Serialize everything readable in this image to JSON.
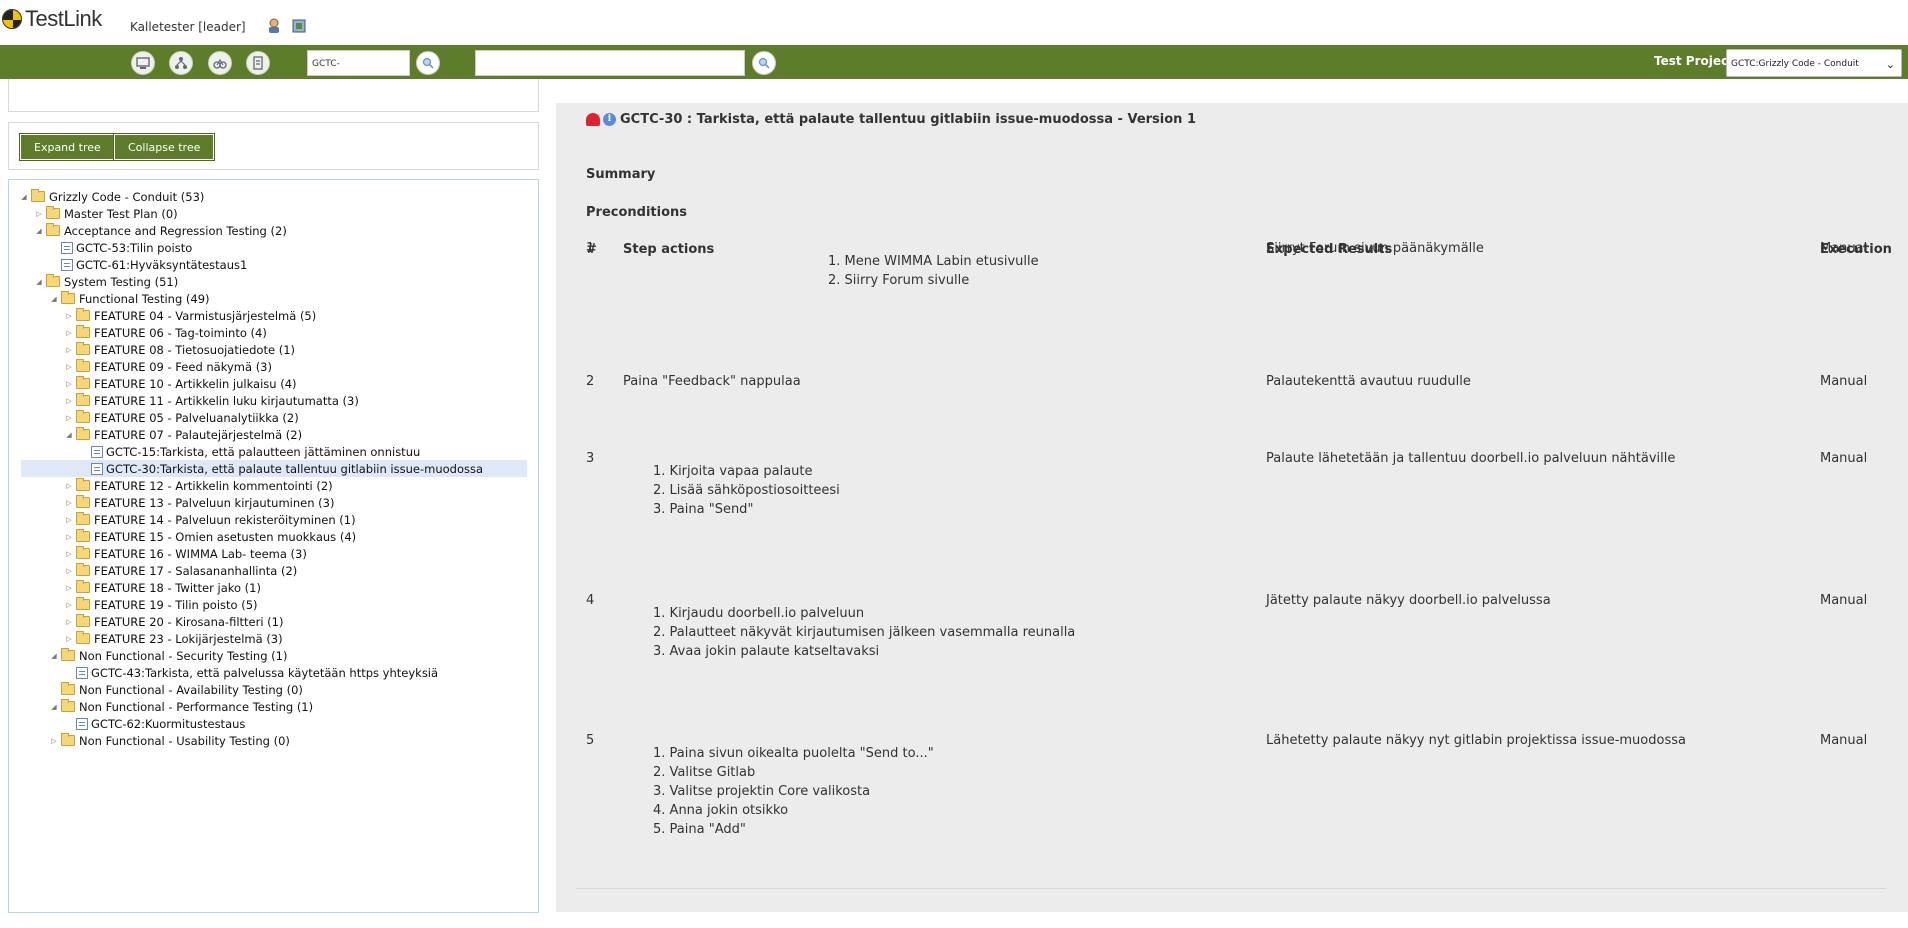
{
  "app": {
    "logo_text": "TestLink",
    "user": "Kalletester [leader]"
  },
  "nav": {
    "tc_input_value": "GCTC-",
    "search_value": "",
    "project_label": "Test Project",
    "project_selected": "GCTC:Grizzly Code - Conduit"
  },
  "left": {
    "expand_label": "Expand tree",
    "collapse_label": "Collapse tree"
  },
  "tree": [
    {
      "label": "Grizzly Code - Conduit (53)",
      "type": "folder",
      "toggle": "open"
    },
    {
      "label": "Master Test Plan (0)",
      "type": "folder",
      "toggle": "closed"
    },
    {
      "label": "Acceptance and Regression Testing (2)",
      "type": "folder",
      "toggle": "open"
    },
    {
      "label": "GCTC-53:Tilin poisto",
      "type": "tc",
      "toggle": ""
    },
    {
      "label": "GCTC-61:Hyväksyntätestaus1",
      "type": "tc",
      "toggle": ""
    },
    {
      "label": "System Testing (51)",
      "type": "folder",
      "toggle": "open"
    },
    {
      "label": "Functional Testing (49)",
      "type": "folder",
      "toggle": "open"
    },
    {
      "label": "FEATURE 04 - Varmistusjärjestelmä (5)",
      "type": "folder",
      "toggle": "closed"
    },
    {
      "label": "FEATURE 06 - Tag-toiminto (4)",
      "type": "folder",
      "toggle": "closed"
    },
    {
      "label": "FEATURE 08 - Tietosuojatiedote (1)",
      "type": "folder",
      "toggle": "closed"
    },
    {
      "label": "FEATURE 09 - Feed näkymä (3)",
      "type": "folder",
      "toggle": "closed"
    },
    {
      "label": "FEATURE 10 - Artikkelin julkaisu (4)",
      "type": "folder",
      "toggle": "closed"
    },
    {
      "label": "FEATURE 11 - Artikkelin luku kirjautumatta (3)",
      "type": "folder",
      "toggle": "closed"
    },
    {
      "label": "FEATURE 05 - Palveluanalytiikka (2)",
      "type": "folder",
      "toggle": "closed"
    },
    {
      "label": "FEATURE 07 - Palautejärjestelmä (2)",
      "type": "folder",
      "toggle": "open"
    },
    {
      "label": "GCTC-15:Tarkista, että palautteen jättäminen onnistuu",
      "type": "tc",
      "toggle": ""
    },
    {
      "label": "GCTC-30:Tarkista, että palaute tallentuu gitlabiin issue-muodossa",
      "type": "tc",
      "toggle": "",
      "selected": true
    },
    {
      "label": "FEATURE 12 - Artikkelin kommentointi (2)",
      "type": "folder",
      "toggle": "closed"
    },
    {
      "label": "FEATURE 13 - Palveluun kirjautuminen (3)",
      "type": "folder",
      "toggle": "closed"
    },
    {
      "label": "FEATURE 14 - Palveluun rekisteröityminen (1)",
      "type": "folder",
      "toggle": "closed"
    },
    {
      "label": "FEATURE 15 - Omien asetusten muokkaus (4)",
      "type": "folder",
      "toggle": "closed"
    },
    {
      "label": "FEATURE 16 - WIMMA Lab- teema (3)",
      "type": "folder",
      "toggle": "closed"
    },
    {
      "label": "FEATURE 17 - Salasananhallinta (2)",
      "type": "folder",
      "toggle": "closed"
    },
    {
      "label": "FEATURE 18 - Twitter jako (1)",
      "type": "folder",
      "toggle": "closed"
    },
    {
      "label": "FEATURE 19 - Tilin poisto (5)",
      "type": "folder",
      "toggle": "closed"
    },
    {
      "label": "FEATURE 20 - Kirosana-filtteri (1)",
      "type": "folder",
      "toggle": "closed"
    },
    {
      "label": "FEATURE 23 - Lokijärjestelmä (3)",
      "type": "folder",
      "toggle": "closed"
    },
    {
      "label": "Non Functional - Security Testing (1)",
      "type": "folder",
      "toggle": "open"
    },
    {
      "label": "GCTC-43:Tarkista, että palvelussa käytetään https yhteyksiä",
      "type": "tc",
      "toggle": ""
    },
    {
      "label": "Non Functional - Availability Testing (0)",
      "type": "folder",
      "toggle": ""
    },
    {
      "label": "Non Functional - Performance Testing (1)",
      "type": "folder",
      "toggle": "open"
    },
    {
      "label": "GCTC-62:Kuormitustestaus",
      "type": "tc",
      "toggle": ""
    },
    {
      "label": "Non Functional - Usability Testing (0)",
      "type": "folder",
      "toggle": "closed"
    }
  ],
  "tc": {
    "title": "GCTC-30 : Tarkista, että palaute tallentuu gitlabiin issue-muodossa - Version 1",
    "summary_label": "Summary",
    "preconditions_label": "Preconditions",
    "headers": {
      "num": "#",
      "actions": "Step actions",
      "expected": "Expected Results",
      "execution": "Execution"
    },
    "steps": [
      {
        "num": "1",
        "text": "",
        "list": [
          "Mene WIMMA Labin etusivulle",
          "Siirry Forum sivulle"
        ],
        "expected": "Siirryt Forum sivun päänäkymälle",
        "exec": "Manual"
      },
      {
        "num": "2",
        "text": "Paina \"Feedback\" nappulaa",
        "list": [],
        "expected": "Palautekenttä avautuu ruudulle",
        "exec": "Manual"
      },
      {
        "num": "3",
        "text": "",
        "list": [
          "Kirjoita vapaa palaute",
          "Lisää sähköpostiosoitteesi",
          "Paina \"Send\""
        ],
        "expected": "Palaute lähetetään ja tallentuu doorbell.io palveluun nähtäville",
        "exec": "Manual"
      },
      {
        "num": "4",
        "text": "",
        "list": [
          "Kirjaudu doorbell.io palveluun",
          "Palautteet näkyvät kirjautumisen jälkeen vasemmalla reunalla",
          "Avaa jokin palaute katseltavaksi"
        ],
        "expected": "Jätetty palaute näkyy doorbell.io palvelussa",
        "exec": "Manual"
      },
      {
        "num": "5",
        "text": "",
        "list": [
          "Paina sivun oikealta puolelta \"Send to...\"",
          "Valitse Gitlab",
          "Valitse projektin Core valikosta",
          "Anna jokin otsikko",
          "Paina \"Add\""
        ],
        "expected": "Lähetetty palaute näkyy nyt gitlabin projektissa issue-muodossa",
        "exec": "Manual"
      }
    ]
  }
}
